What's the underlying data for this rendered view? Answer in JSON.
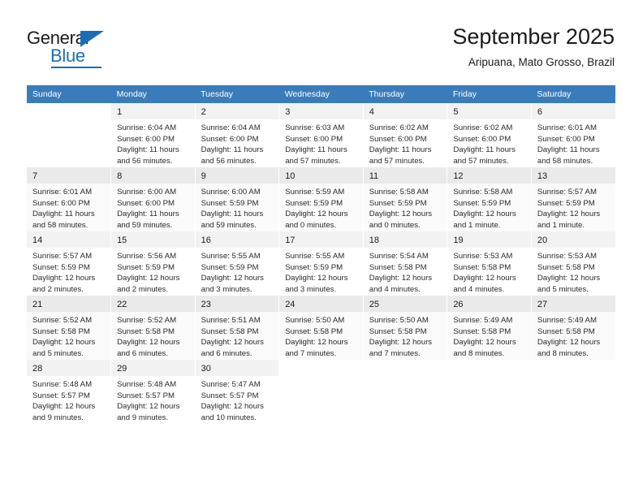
{
  "brand": {
    "name_top": "General",
    "name_bottom": "Blue"
  },
  "header": {
    "title": "September 2025",
    "location": "Aripuana, Mato Grosso, Brazil"
  },
  "calendar": {
    "weekday_headers": [
      "Sunday",
      "Monday",
      "Tuesday",
      "Wednesday",
      "Thursday",
      "Friday",
      "Saturday"
    ],
    "accent_color": "#3a7cba",
    "weeks": [
      [
        {
          "day": "",
          "lines": []
        },
        {
          "day": "1",
          "lines": [
            "Sunrise: 6:04 AM",
            "Sunset: 6:00 PM",
            "Daylight: 11 hours",
            "and 56 minutes."
          ]
        },
        {
          "day": "2",
          "lines": [
            "Sunrise: 6:04 AM",
            "Sunset: 6:00 PM",
            "Daylight: 11 hours",
            "and 56 minutes."
          ]
        },
        {
          "day": "3",
          "lines": [
            "Sunrise: 6:03 AM",
            "Sunset: 6:00 PM",
            "Daylight: 11 hours",
            "and 57 minutes."
          ]
        },
        {
          "day": "4",
          "lines": [
            "Sunrise: 6:02 AM",
            "Sunset: 6:00 PM",
            "Daylight: 11 hours",
            "and 57 minutes."
          ]
        },
        {
          "day": "5",
          "lines": [
            "Sunrise: 6:02 AM",
            "Sunset: 6:00 PM",
            "Daylight: 11 hours",
            "and 57 minutes."
          ]
        },
        {
          "day": "6",
          "lines": [
            "Sunrise: 6:01 AM",
            "Sunset: 6:00 PM",
            "Daylight: 11 hours",
            "and 58 minutes."
          ]
        }
      ],
      [
        {
          "day": "7",
          "lines": [
            "Sunrise: 6:01 AM",
            "Sunset: 6:00 PM",
            "Daylight: 11 hours",
            "and 58 minutes."
          ]
        },
        {
          "day": "8",
          "lines": [
            "Sunrise: 6:00 AM",
            "Sunset: 6:00 PM",
            "Daylight: 11 hours",
            "and 59 minutes."
          ]
        },
        {
          "day": "9",
          "lines": [
            "Sunrise: 6:00 AM",
            "Sunset: 5:59 PM",
            "Daylight: 11 hours",
            "and 59 minutes."
          ]
        },
        {
          "day": "10",
          "lines": [
            "Sunrise: 5:59 AM",
            "Sunset: 5:59 PM",
            "Daylight: 12 hours",
            "and 0 minutes."
          ]
        },
        {
          "day": "11",
          "lines": [
            "Sunrise: 5:58 AM",
            "Sunset: 5:59 PM",
            "Daylight: 12 hours",
            "and 0 minutes."
          ]
        },
        {
          "day": "12",
          "lines": [
            "Sunrise: 5:58 AM",
            "Sunset: 5:59 PM",
            "Daylight: 12 hours",
            "and 1 minute."
          ]
        },
        {
          "day": "13",
          "lines": [
            "Sunrise: 5:57 AM",
            "Sunset: 5:59 PM",
            "Daylight: 12 hours",
            "and 1 minute."
          ]
        }
      ],
      [
        {
          "day": "14",
          "lines": [
            "Sunrise: 5:57 AM",
            "Sunset: 5:59 PM",
            "Daylight: 12 hours",
            "and 2 minutes."
          ]
        },
        {
          "day": "15",
          "lines": [
            "Sunrise: 5:56 AM",
            "Sunset: 5:59 PM",
            "Daylight: 12 hours",
            "and 2 minutes."
          ]
        },
        {
          "day": "16",
          "lines": [
            "Sunrise: 5:55 AM",
            "Sunset: 5:59 PM",
            "Daylight: 12 hours",
            "and 3 minutes."
          ]
        },
        {
          "day": "17",
          "lines": [
            "Sunrise: 5:55 AM",
            "Sunset: 5:59 PM",
            "Daylight: 12 hours",
            "and 3 minutes."
          ]
        },
        {
          "day": "18",
          "lines": [
            "Sunrise: 5:54 AM",
            "Sunset: 5:58 PM",
            "Daylight: 12 hours",
            "and 4 minutes."
          ]
        },
        {
          "day": "19",
          "lines": [
            "Sunrise: 5:53 AM",
            "Sunset: 5:58 PM",
            "Daylight: 12 hours",
            "and 4 minutes."
          ]
        },
        {
          "day": "20",
          "lines": [
            "Sunrise: 5:53 AM",
            "Sunset: 5:58 PM",
            "Daylight: 12 hours",
            "and 5 minutes."
          ]
        }
      ],
      [
        {
          "day": "21",
          "lines": [
            "Sunrise: 5:52 AM",
            "Sunset: 5:58 PM",
            "Daylight: 12 hours",
            "and 5 minutes."
          ]
        },
        {
          "day": "22",
          "lines": [
            "Sunrise: 5:52 AM",
            "Sunset: 5:58 PM",
            "Daylight: 12 hours",
            "and 6 minutes."
          ]
        },
        {
          "day": "23",
          "lines": [
            "Sunrise: 5:51 AM",
            "Sunset: 5:58 PM",
            "Daylight: 12 hours",
            "and 6 minutes."
          ]
        },
        {
          "day": "24",
          "lines": [
            "Sunrise: 5:50 AM",
            "Sunset: 5:58 PM",
            "Daylight: 12 hours",
            "and 7 minutes."
          ]
        },
        {
          "day": "25",
          "lines": [
            "Sunrise: 5:50 AM",
            "Sunset: 5:58 PM",
            "Daylight: 12 hours",
            "and 7 minutes."
          ]
        },
        {
          "day": "26",
          "lines": [
            "Sunrise: 5:49 AM",
            "Sunset: 5:58 PM",
            "Daylight: 12 hours",
            "and 8 minutes."
          ]
        },
        {
          "day": "27",
          "lines": [
            "Sunrise: 5:49 AM",
            "Sunset: 5:58 PM",
            "Daylight: 12 hours",
            "and 8 minutes."
          ]
        }
      ],
      [
        {
          "day": "28",
          "lines": [
            "Sunrise: 5:48 AM",
            "Sunset: 5:57 PM",
            "Daylight: 12 hours",
            "and 9 minutes."
          ]
        },
        {
          "day": "29",
          "lines": [
            "Sunrise: 5:48 AM",
            "Sunset: 5:57 PM",
            "Daylight: 12 hours",
            "and 9 minutes."
          ]
        },
        {
          "day": "30",
          "lines": [
            "Sunrise: 5:47 AM",
            "Sunset: 5:57 PM",
            "Daylight: 12 hours",
            "and 10 minutes."
          ]
        },
        {
          "day": "",
          "lines": []
        },
        {
          "day": "",
          "lines": []
        },
        {
          "day": "",
          "lines": []
        },
        {
          "day": "",
          "lines": []
        }
      ]
    ]
  }
}
